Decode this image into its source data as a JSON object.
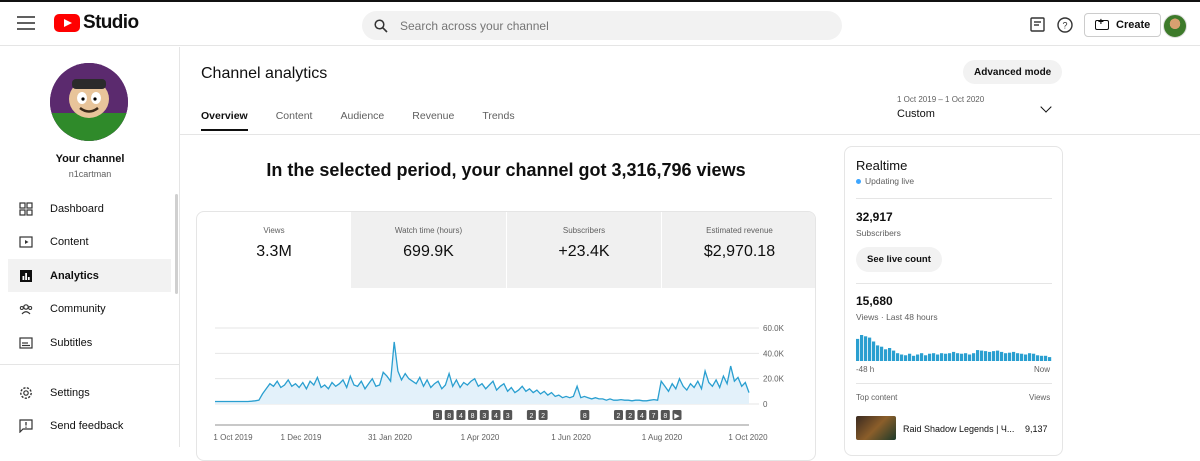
{
  "header": {
    "logo_text": "Studio",
    "search_placeholder": "Search across your channel",
    "create_label": "Create"
  },
  "sidebar": {
    "channel_label": "Your channel",
    "channel_handle": "n1cartman",
    "items": [
      {
        "label": "Dashboard",
        "icon": "dashboard-icon"
      },
      {
        "label": "Content",
        "icon": "content-icon"
      },
      {
        "label": "Analytics",
        "icon": "analytics-icon",
        "active": true
      },
      {
        "label": "Community",
        "icon": "community-icon"
      },
      {
        "label": "Subtitles",
        "icon": "subtitles-icon"
      }
    ],
    "bottom_items": [
      {
        "label": "Settings",
        "icon": "gear-icon"
      },
      {
        "label": "Send feedback",
        "icon": "feedback-icon"
      }
    ]
  },
  "main": {
    "title": "Channel analytics",
    "advanced_mode_label": "Advanced mode",
    "tabs": [
      "Overview",
      "Content",
      "Audience",
      "Revenue",
      "Trends"
    ],
    "date_range": "1 Oct 2019 – 1 Oct 2020",
    "date_preset": "Custom",
    "headline": "In the selected period, your channel got 3,316,796 views",
    "metrics": [
      {
        "label": "Views",
        "value": "3.3M"
      },
      {
        "label": "Watch time (hours)",
        "value": "699.9K"
      },
      {
        "label": "Subscribers",
        "value": "+23.4K"
      },
      {
        "label": "Estimated revenue",
        "value": "$2,970.18"
      }
    ]
  },
  "realtime": {
    "title": "Realtime",
    "status": "Updating live",
    "subscribers_value": "32,917",
    "subscribers_label": "Subscribers",
    "live_count_button": "See live count",
    "views_value": "15,680",
    "views_label": "Views · Last 48 hours",
    "axis_start": "-48 h",
    "axis_end": "Now",
    "top_content_label": "Top content",
    "views_col_label": "Views",
    "top_video_title": "Raid Shadow Legends | Ч...",
    "top_video_views": "9,137",
    "bars": [
      0.85,
      1.0,
      0.95,
      0.9,
      0.75,
      0.6,
      0.55,
      0.45,
      0.5,
      0.4,
      0.3,
      0.25,
      0.22,
      0.28,
      0.2,
      0.25,
      0.3,
      0.22,
      0.28,
      0.3,
      0.25,
      0.3,
      0.28,
      0.3,
      0.35,
      0.3,
      0.28,
      0.3,
      0.25,
      0.3,
      0.42,
      0.4,
      0.38,
      0.35,
      0.38,
      0.4,
      0.35,
      0.3,
      0.32,
      0.35,
      0.3,
      0.28,
      0.25,
      0.3,
      0.28,
      0.22,
      0.2,
      0.2,
      0.15
    ]
  },
  "chart_data": {
    "type": "line",
    "title": "",
    "xlabel": "",
    "ylabel": "",
    "x_ticks": [
      "1 Oct 2019",
      "1 Dec 2019",
      "31 Jan 2020",
      "1 Apr 2020",
      "1 Jun 2020",
      "1 Aug 2020",
      "1 Oct 2020"
    ],
    "y_ticks": [
      "0",
      "20.0K",
      "40.0K",
      "60.0K"
    ],
    "ylim": [
      0,
      60000
    ],
    "series": [
      {
        "values": [
          2000,
          2000,
          2000,
          2000,
          2000,
          2000,
          2000,
          2000,
          2000,
          2000,
          2200,
          2500,
          3000,
          8000,
          12000,
          16000,
          14000,
          18000,
          13000,
          15000,
          19000,
          14000,
          16000,
          13000,
          17000,
          12000,
          18000,
          15000,
          21000,
          13000,
          15000,
          12000,
          17000,
          14000,
          16000,
          19000,
          13000,
          22000,
          15000,
          14000,
          18000,
          12000,
          16000,
          20000,
          14000,
          15000,
          25000,
          22000,
          18000,
          49000,
          26000,
          19000,
          24000,
          20000,
          18000,
          16000,
          21000,
          14000,
          19000,
          13000,
          16000,
          18000,
          12000,
          15000,
          24000,
          14000,
          19000,
          13000,
          17000,
          15000,
          18000,
          20000,
          14000,
          16000,
          12000,
          15000,
          18000,
          11000,
          14000,
          16000,
          10000,
          13000,
          9000,
          11000,
          14000,
          10000,
          12000,
          9000,
          11000,
          8000,
          10000,
          7000,
          9000,
          6000,
          7000,
          5000,
          6000,
          5000,
          6000,
          14000,
          5000,
          6000,
          5000,
          4000,
          5000,
          4000,
          4000,
          3000,
          4000,
          3000,
          3000,
          3500,
          3000,
          3000,
          2500,
          3000,
          3000,
          2500,
          2500,
          3000,
          3500,
          3000,
          18000,
          14000,
          10000,
          16000,
          12000,
          20000,
          14000,
          11000,
          16000,
          13000,
          18000,
          12000,
          26000,
          17000,
          14000,
          19000,
          13000,
          22000,
          16000,
          30000,
          18000,
          21000,
          14000,
          17000,
          9000
        ]
      }
    ],
    "markers": [
      "9",
      "8",
      "4",
      "8",
      "3",
      "4",
      "3",
      "2",
      "2",
      "8",
      "2",
      "2",
      "4",
      "7",
      "8",
      "▶"
    ]
  }
}
